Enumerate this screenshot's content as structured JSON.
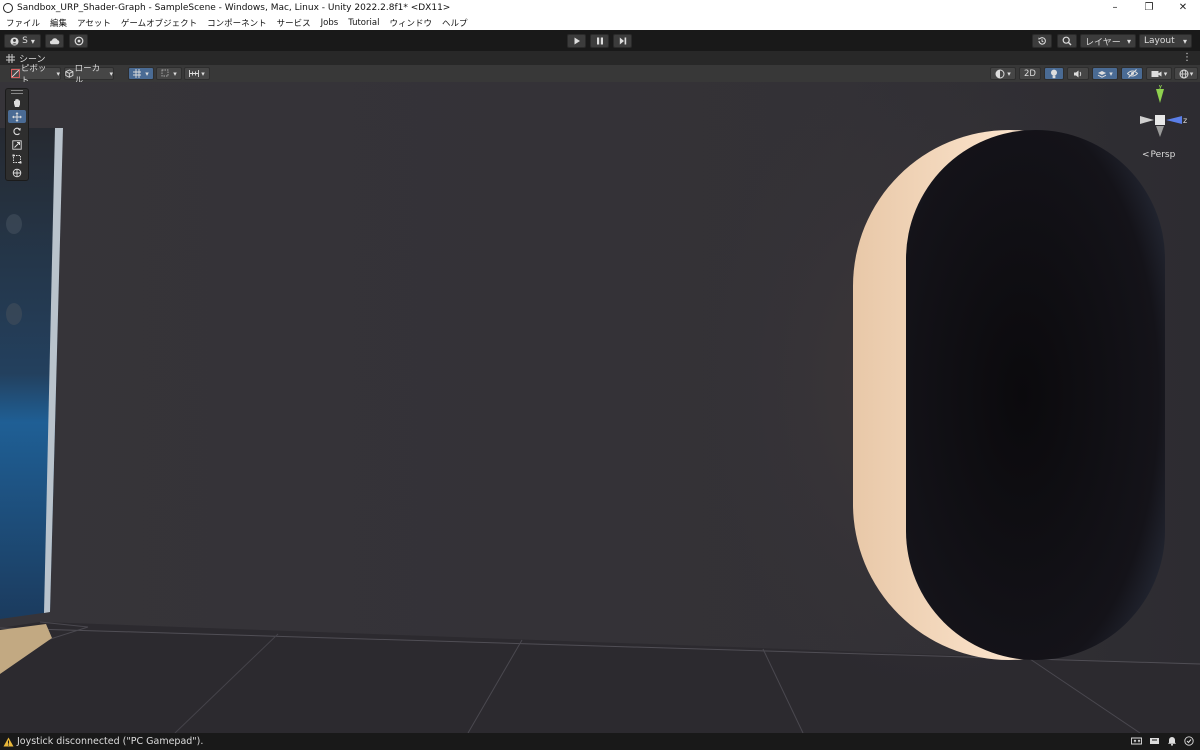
{
  "window": {
    "title": "Sandbox_URP_Shader-Graph - SampleScene - Windows, Mac, Linux - Unity 2022.2.8f1* <DX11>",
    "minimize": "–",
    "maximize": "❐",
    "close": "✕"
  },
  "menu": [
    "ファイル",
    "編集",
    "アセット",
    "ゲームオブジェクト",
    "コンポーネント",
    "サービス",
    "Jobs",
    "Tutorial",
    "ウィンドウ",
    "ヘルプ"
  ],
  "toolbar": {
    "account_label": "S",
    "layers_label": "レイヤー",
    "layout_label": "Layout"
  },
  "scene_tab": {
    "label": "シーン"
  },
  "scene_toolbar": {
    "pivot_label": "ピボット",
    "local_label": "ローカル",
    "mode_2d": "2D"
  },
  "gizmo": {
    "y_axis": "y",
    "z_axis": "z",
    "projection": "Persp"
  },
  "status": {
    "message": "Joystick disconnected (\"PC Gamepad\")."
  },
  "colors": {
    "accent_blue": "#4a6b94",
    "warning_yellow": "#e8b73a",
    "gizmo_y": "#8fd14f",
    "gizmo_z": "#5a7ee8"
  }
}
